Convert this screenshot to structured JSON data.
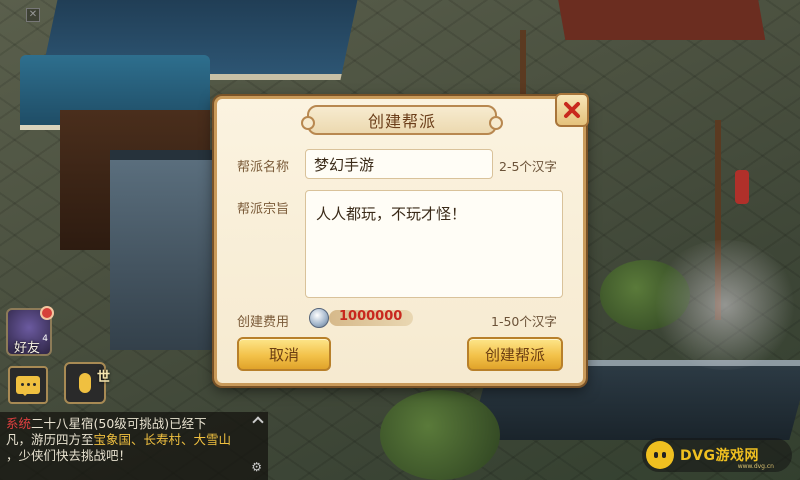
{
  "dialog": {
    "title": "创建帮派",
    "name_label": "帮派名称",
    "name_value": "梦幻手游",
    "name_hint": "2-5个汉字",
    "motto_label": "帮派宗旨",
    "motto_value": "人人都玩，不玩才怪！",
    "cost_label": "创建费用",
    "cost_value": "1000000",
    "motto_hint": "1-50个汉字",
    "cancel_label": "取消",
    "create_label": "创建帮派"
  },
  "hud": {
    "friends_label": "好友",
    "friends_count": "4",
    "voice_tag": "世"
  },
  "chat": {
    "channel": "系统",
    "line1": "二十八星宿(50级可挑战)已经下",
    "line2_pre": "凡，游历四方至",
    "line2_hl": "宝象国、长寿村、大雪山",
    "line3": "，少侠们快去挑战吧！"
  },
  "watermark": {
    "text": "DVG游戏网",
    "sub": "www.dvg.cn"
  },
  "colors": {
    "accent_gold": "#f3c24a",
    "close_red": "#c8281e",
    "cost_red": "#c8281e"
  }
}
